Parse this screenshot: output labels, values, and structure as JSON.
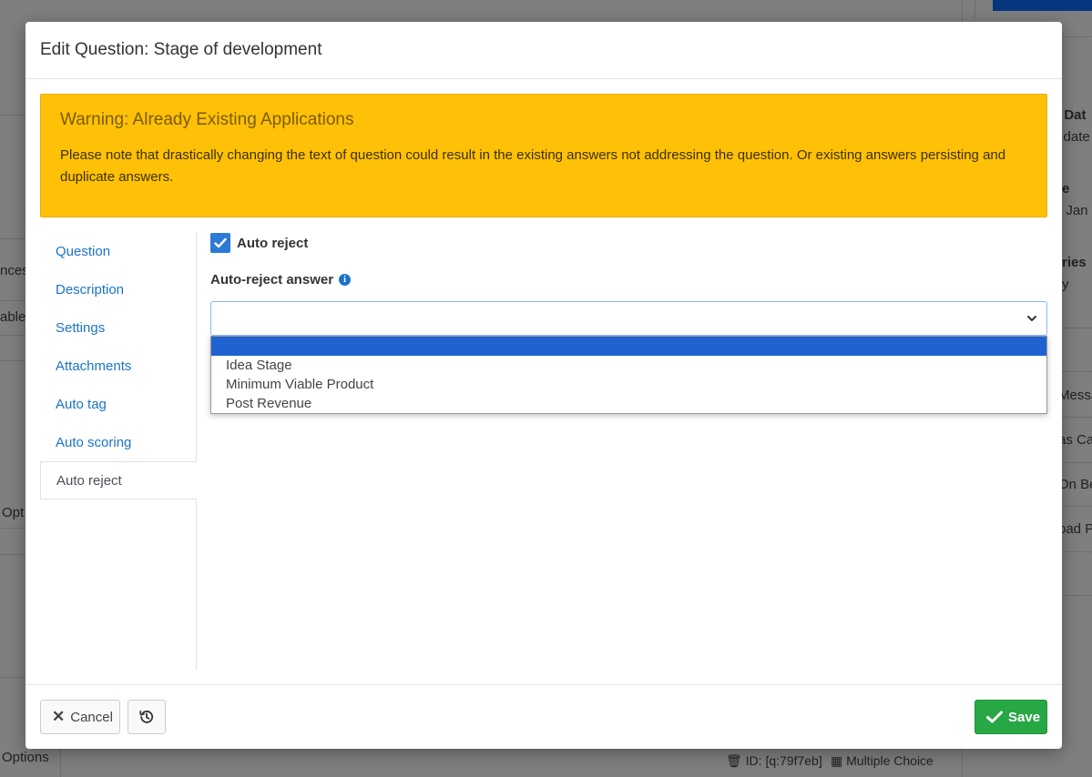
{
  "background": {
    "texts": [
      {
        "text": "g Dat",
        "bold": true
      },
      {
        "text": "g date",
        "bold": false
      },
      {
        "text": "e",
        "bold": true
      },
      {
        "text": ", Jan",
        "bold": false
      },
      {
        "text": "ries",
        "bold": true
      },
      {
        "text": "y",
        "bold": false
      },
      {
        "text": "Messa",
        "bold": false
      },
      {
        "text": "as Car",
        "bold": false
      },
      {
        "text": "On Be",
        "bold": false
      },
      {
        "text": "oad P",
        "bold": false
      },
      {
        "text": "nces",
        "bold": false
      },
      {
        "text": "able",
        "bold": false
      },
      {
        "text": "Opt",
        "bold": false
      },
      {
        "text": "Options",
        "bold": false
      },
      {
        "text": "ID: [q:79f7eb]",
        "bold": false
      },
      {
        "text": "Multiple Choice",
        "bold": false
      }
    ]
  },
  "modal": {
    "title": "Edit Question: Stage of development",
    "warning": {
      "title": "Warning: Already Existing Applications",
      "text": "Please note that drastically changing the text of question could result in the existing answers not addressing the question. Or existing answers persisting and duplicate answers."
    },
    "nav": [
      {
        "label": "Question"
      },
      {
        "label": "Description"
      },
      {
        "label": "Settings"
      },
      {
        "label": "Attachments"
      },
      {
        "label": "Auto tag"
      },
      {
        "label": "Auto scoring"
      },
      {
        "label": "Auto reject"
      }
    ],
    "active_tab": "Auto reject",
    "auto_reject": {
      "checkbox_label": "Auto reject",
      "checked": true,
      "answer_label": "Auto-reject answer",
      "selected_value": "",
      "options": [
        "",
        "Idea Stage",
        "Minimum Viable Product",
        "Post Revenue"
      ]
    },
    "footer": {
      "cancel_label": "Cancel",
      "save_label": "Save"
    }
  },
  "colors": {
    "warning": "#ffc107",
    "link": "#1a73c9",
    "save": "#28a745",
    "dropdown_highlight": "#1e63cf"
  }
}
